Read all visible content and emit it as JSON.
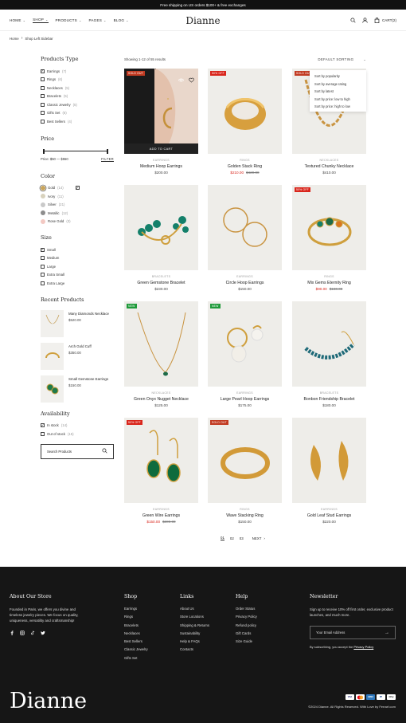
{
  "topbar": {
    "text": "Free shipping on US orders $100+ & free exchanges"
  },
  "header": {
    "nav": [
      {
        "label": "HOME"
      },
      {
        "label": "SHOP"
      },
      {
        "label": "PRODUCTS"
      },
      {
        "label": "PAGES"
      },
      {
        "label": "BLOG"
      }
    ],
    "logo": "Dianne",
    "cart_label": "CART(2)"
  },
  "breadcrumb": {
    "home": "Home",
    "current": "Shop Left Sidebar"
  },
  "sidebar": {
    "product_type": {
      "title": "Products Type",
      "items": [
        {
          "label": "Earrings",
          "count": "(7)",
          "checked": true
        },
        {
          "label": "Rings",
          "count": "(6)",
          "checked": false
        },
        {
          "label": "Necklaces",
          "count": "(5)",
          "checked": false
        },
        {
          "label": "Bracelets",
          "count": "(5)",
          "checked": false
        },
        {
          "label": "Classic Jewelry",
          "count": "(5)",
          "checked": false
        },
        {
          "label": "Gifts Set",
          "count": "(6)",
          "checked": false
        },
        {
          "label": "Best Sellers",
          "count": "(4)",
          "checked": false
        }
      ]
    },
    "price": {
      "title": "Price",
      "range_text": "Price: $50 — $550",
      "filter_label": "FILTER"
    },
    "color": {
      "title": "Color",
      "items": [
        {
          "label": "Gold",
          "count": "(14)",
          "hex": "#c9a45a"
        },
        {
          "label": "Ivory",
          "count": "(11)",
          "hex": "#d8d2bd"
        },
        {
          "label": "Silver",
          "count": "(21)",
          "hex": "#c9c9c9"
        },
        {
          "label": "Metallic",
          "count": "(12)",
          "hex": "#8d8d8d"
        },
        {
          "label": "Rose Gold",
          "count": "(3)",
          "hex": "#f3c9c3"
        }
      ]
    },
    "size": {
      "title": "Size",
      "items": [
        {
          "label": "Small",
          "checked": true
        },
        {
          "label": "Medium",
          "checked": false
        },
        {
          "label": "Large",
          "checked": false
        },
        {
          "label": "Extra Small",
          "checked": false
        },
        {
          "label": "Extra Large",
          "checked": false
        }
      ]
    },
    "recent": {
      "title": "Recent Products",
      "items": [
        {
          "name": "Many Diamonds Necklace",
          "price": "$520.00"
        },
        {
          "name": "Arch Gold Cuff",
          "price": "$350.00"
        },
        {
          "name": "Small Gemstone Earrings",
          "price": "$150.00"
        }
      ]
    },
    "availability": {
      "title": "Availability",
      "items": [
        {
          "label": "In stock",
          "count": "(14)",
          "checked": true
        },
        {
          "label": "Out of stock",
          "count": "(15)",
          "checked": false
        }
      ]
    },
    "search_placeholder": "Search Products"
  },
  "toolbar": {
    "showing": "Showing 1-12 of 55 results",
    "sort_label": "DEFAULT SORTING"
  },
  "sort_menu": [
    "Sort by popularity",
    "Sort by average rating",
    "Sort by latest",
    "Sort by price: low to high",
    "Sort by price: high to low"
  ],
  "products": [
    {
      "name": "Medium Hoop Earrings",
      "category": "EARRINGS",
      "price": "$200.00",
      "badge": "SOLD OUT",
      "add_to_cart": "ADD TO CART"
    },
    {
      "name": "Golden Stack Ring",
      "category": "RINGS",
      "price": "$210.00",
      "old_price": "$420.00",
      "badge": "50% OFF"
    },
    {
      "name": "Textured Chunky Necklace",
      "category": "NECKLACES",
      "price": "$410.00",
      "badge": "SOLD OUT"
    },
    {
      "name": "Green Gemstone Bracelet",
      "category": "BRACELETS",
      "price": "$230.00"
    },
    {
      "name": "Circle Hoop Earrings",
      "category": "EARRINGS",
      "price": "$150.00"
    },
    {
      "name": "Mix Gems Eternity Ring",
      "category": "RINGS",
      "price": "$90.00",
      "old_price": "$180.00",
      "badge": "50% OFF"
    },
    {
      "name": "Green Onyx Nugget Necklace",
      "category": "NECKLACES",
      "price": "$125.00",
      "badge": "NEW"
    },
    {
      "name": "Large Pearl Hoop Earrings",
      "category": "EARRINGS",
      "price": "$175.00",
      "badge": "NEW"
    },
    {
      "name": "Bonbon Friendship Bracelet",
      "category": "BRACELETS",
      "price": "$180.00"
    },
    {
      "name": "Green Wire Earrings",
      "category": "EARRINGS",
      "price": "$150.00",
      "old_price": "$300.00",
      "badge": "50% OFF"
    },
    {
      "name": "Wave Stacking Ring",
      "category": "RINGS",
      "price": "$150.00",
      "badge": "SOLD OUT"
    },
    {
      "name": "Gold Leaf Stud Earrings",
      "category": "EARRINGS",
      "price": "$220.00"
    }
  ],
  "pagination": {
    "pages": [
      "01",
      "02",
      "03"
    ],
    "next": "NEXT"
  },
  "footer": {
    "about": {
      "title": "About Our Store",
      "text": "Founded in Paris, we offers you divine and timeless jewelry pieces. We focus on quality, uniqueness, versatility and craftsmanship!"
    },
    "shop": {
      "title": "Shop",
      "links": [
        "Earrings",
        "Rings",
        "Bracelets",
        "Necklaces",
        "Best Sellers",
        "Classic Jewelry",
        "Gifts Set"
      ]
    },
    "links": {
      "title": "Links",
      "links": [
        "About Us",
        "Store Locations",
        "Shipping & Returns",
        "Sustainability",
        "Help & FAQs",
        "Contacts"
      ]
    },
    "help": {
      "title": "Help",
      "links": [
        "Order Status",
        "Privacy Policy",
        "Refund policy",
        "Gift Cards",
        "Size Guide"
      ]
    },
    "newsletter": {
      "title": "Newsletter",
      "text": "Sign up to receive 10% off first order, exclusive product launches, and much more.",
      "placeholder": "Your Email Address",
      "note_prefix": "By subscribing, you accept the",
      "note_link": "Privacy Policy"
    },
    "logo": "Dianne",
    "copyright": "©2024 Dianne. All Rights Reserved. With Love by Ferrarf.com",
    "payments": [
      "VISA",
      "MC",
      "AMEX",
      "PP",
      "GPay"
    ]
  }
}
